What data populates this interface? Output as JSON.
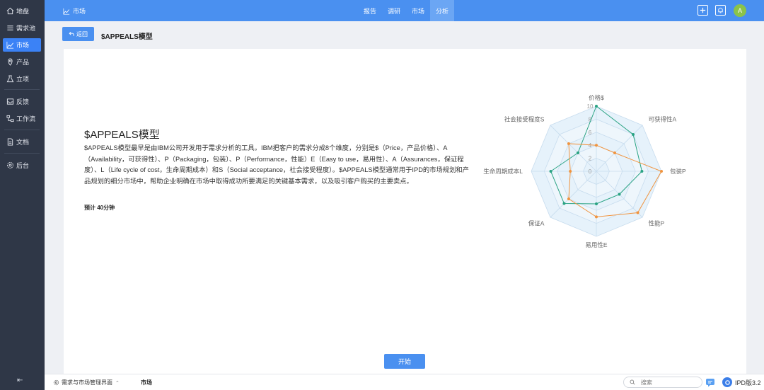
{
  "sidebar": {
    "items": [
      {
        "label": "地盘",
        "icon": "home-icon"
      },
      {
        "label": "需求池",
        "icon": "list-icon"
      },
      {
        "label": "市场",
        "icon": "chart-icon"
      },
      {
        "label": "产品",
        "icon": "location-icon"
      },
      {
        "label": "立项",
        "icon": "flask-icon"
      },
      {
        "label": "反馈",
        "icon": "inbox-icon"
      },
      {
        "label": "工作流",
        "icon": "workflow-icon"
      },
      {
        "label": "文档",
        "icon": "document-icon"
      },
      {
        "label": "后台",
        "icon": "gear-icon"
      }
    ],
    "collapse": "⇤"
  },
  "topbar": {
    "title": "市场",
    "tabs": [
      "报告",
      "调研",
      "市场",
      "分析"
    ],
    "active_tab": "分析",
    "avatar": "A"
  },
  "header": {
    "back_label": "返回",
    "page_title": "$APPEALS模型"
  },
  "main": {
    "title": "$APPEALS模型",
    "description": "$APPEALS模型最早是由IBM公司开发用于需求分析的工具。IBM把客户的需求分成8个维度，分别是$（Price，产品价格）、A（Availability，可获得性）、P（Packaging，包装）、P（Performance，性能）E（Easy to use，易用性）、A（Assurances，保证程度）、L（Life cycle of cost，生命周期成本）和S（Social acceptance，社会接受程度）。$APPEALS模型通常用于IPD的市场规划和产品规划的细分市场中，帮助企业明确在市场中取得成功所要满足的关键基本需求，以及吸引客户购买的主要卖点。",
    "time": "预计 40分钟",
    "start_label": "开始"
  },
  "chart_data": {
    "type": "radar",
    "axes": [
      "价格$",
      "可获得性A",
      "包装P",
      "性能P",
      "易用性E",
      "保证A",
      "生命周期成本L",
      "社会接受程度S"
    ],
    "max": 10,
    "ticks": [
      "0",
      "2",
      "4",
      "6",
      "8",
      "10"
    ],
    "series": [
      {
        "color": "#2aa383",
        "values": [
          10,
          8,
          7,
          5,
          5,
          7,
          7,
          4
        ]
      },
      {
        "color": "#f0943f",
        "values": [
          4,
          4,
          10,
          9,
          7,
          6,
          4,
          6
        ]
      }
    ]
  },
  "bottombar": {
    "module": "需求与市场管理界面",
    "crumb": "市场",
    "search_placeholder": "搜索",
    "version": "IPD版3.2"
  }
}
